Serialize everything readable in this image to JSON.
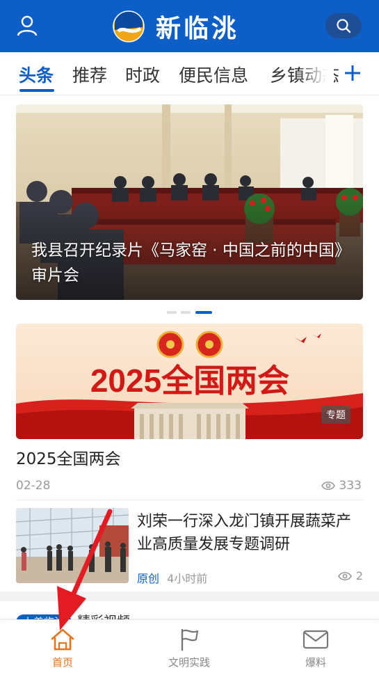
{
  "header": {
    "app_name": "新临洮"
  },
  "tabs": [
    {
      "label": "头条",
      "active": true
    },
    {
      "label": "推荐",
      "active": false
    },
    {
      "label": "时政",
      "active": false
    },
    {
      "label": "便民信息",
      "active": false
    },
    {
      "label": "乡镇动态",
      "active": false
    }
  ],
  "carousel": {
    "caption": "我县召开纪录片《马家窑 · 中国之前的中国》审片会",
    "pages": 3,
    "current_page": 3
  },
  "feature": {
    "banner_text": "2025全国两会",
    "badge": "专题",
    "title": "2025全国两会",
    "date": "02-28",
    "views": "333"
  },
  "news_item": {
    "title": "刘荣一行深入龙门镇开展蔬菜产业高质量发展专题调研",
    "source": "原创",
    "time": "4小时前",
    "views": "2"
  },
  "section_peek": {
    "pill": "上善临洮",
    "title": "精彩视频"
  },
  "bottom_nav": [
    {
      "label": "首页",
      "icon": "home-icon",
      "active": true
    },
    {
      "label": "文明实践",
      "icon": "flag-icon",
      "active": false
    },
    {
      "label": "爆料",
      "icon": "mail-icon",
      "active": false
    }
  ],
  "colors": {
    "brand_blue": "#0d5fc7",
    "active_nav": "#e8731d",
    "arrow_red": "#e31b23"
  }
}
